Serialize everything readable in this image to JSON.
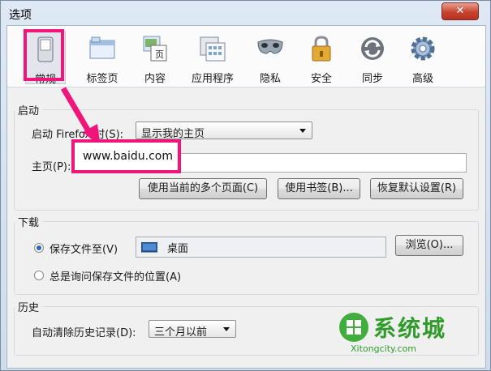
{
  "window": {
    "title": "选项",
    "close_label": "✕"
  },
  "toolbar": [
    {
      "id": "general",
      "label": "常规",
      "icon": "switch-icon",
      "selected": true
    },
    {
      "id": "tabs",
      "label": "标签页",
      "icon": "tabs-icon"
    },
    {
      "id": "content",
      "label": "内容",
      "icon": "content-page-icon"
    },
    {
      "id": "applications",
      "label": "应用程序",
      "icon": "applications-icon"
    },
    {
      "id": "privacy",
      "label": "隐私",
      "icon": "mask-icon"
    },
    {
      "id": "security",
      "label": "安全",
      "icon": "padlock-icon"
    },
    {
      "id": "sync",
      "label": "同步",
      "icon": "sync-icon"
    },
    {
      "id": "advanced",
      "label": "高级",
      "icon": "gear-icon"
    }
  ],
  "startup": {
    "legend": "启动",
    "when_label": "启动 Firefox 时(S):",
    "when_value": "显示我的主页",
    "home_label": "主页(P):",
    "home_value": "www.baidu.com",
    "btn_current": "使用当前的多个页面(C)",
    "btn_bookmark": "使用书签(B)...",
    "btn_default": "恢复默认设置(R)"
  },
  "downloads": {
    "legend": "下载",
    "save_label": "保存文件至(V)",
    "folder": "桌面",
    "browse": "浏览(O)...",
    "ask_label": "总是询问保存文件的位置(A)",
    "save_selected": true
  },
  "history": {
    "legend": "历史",
    "clear_label": "自动清除历史记录(D):",
    "clear_value": "三个月以前"
  },
  "watermark": {
    "text": "系统城",
    "url": "Xitongcity.com"
  },
  "colors": {
    "highlight": "#f0157a"
  }
}
